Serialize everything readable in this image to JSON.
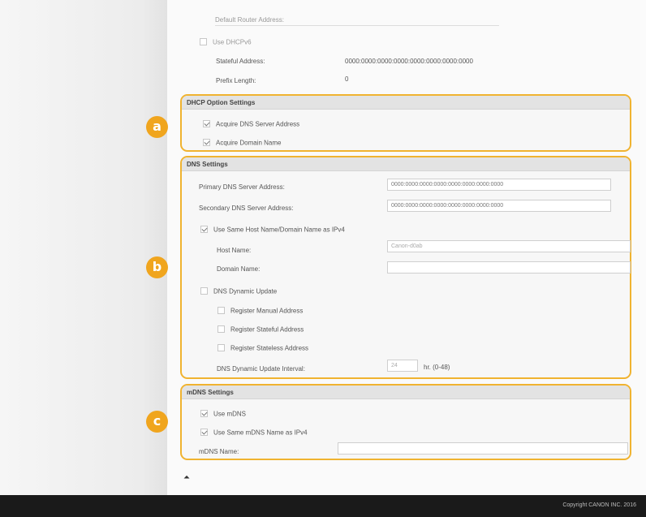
{
  "top": {
    "default_router_label": "Default Router Address:",
    "use_dhcpv6_label": "Use DHCPv6",
    "stateful_address_label": "Stateful Address:",
    "stateful_address_value": "0000:0000:0000:0000:0000:0000:0000:0000",
    "prefix_length_label": "Prefix Length:",
    "prefix_length_value": "0"
  },
  "dhcp": {
    "badge": "a",
    "title": "DHCP Option Settings",
    "acquire_dns_label": "Acquire DNS Server Address",
    "acquire_domain_label": "Acquire Domain Name"
  },
  "dns": {
    "badge": "b",
    "title": "DNS Settings",
    "primary_label": "Primary DNS Server Address:",
    "primary_value": "0000:0000:0000:0000:0000:0000:0000:0000",
    "secondary_label": "Secondary DNS Server Address:",
    "secondary_value": "0000:0000:0000:0000:0000:0000:0000:0000",
    "use_same_host_label": "Use Same Host Name/Domain Name as IPv4",
    "host_name_label": "Host Name:",
    "host_name_value": "Canon-d0ab",
    "domain_name_label": "Domain Name:",
    "domain_name_value": "",
    "dynamic_update_label": "DNS Dynamic Update",
    "register_manual_label": "Register Manual Address",
    "register_stateful_label": "Register Stateful Address",
    "register_stateless_label": "Register Stateless Address",
    "interval_label": "DNS Dynamic Update Interval:",
    "interval_value": "24",
    "interval_unit": "hr. (0-48)"
  },
  "mdns": {
    "badge": "c",
    "title": "mDNS Settings",
    "use_mdns_label": "Use mDNS",
    "use_same_mdns_label": "Use Same mDNS Name as IPv4",
    "mdns_name_label": "mDNS Name:",
    "mdns_name_value": ""
  },
  "top_icon": "⏶",
  "footer": {
    "copyright": "Copyright CANON INC. 2016"
  }
}
